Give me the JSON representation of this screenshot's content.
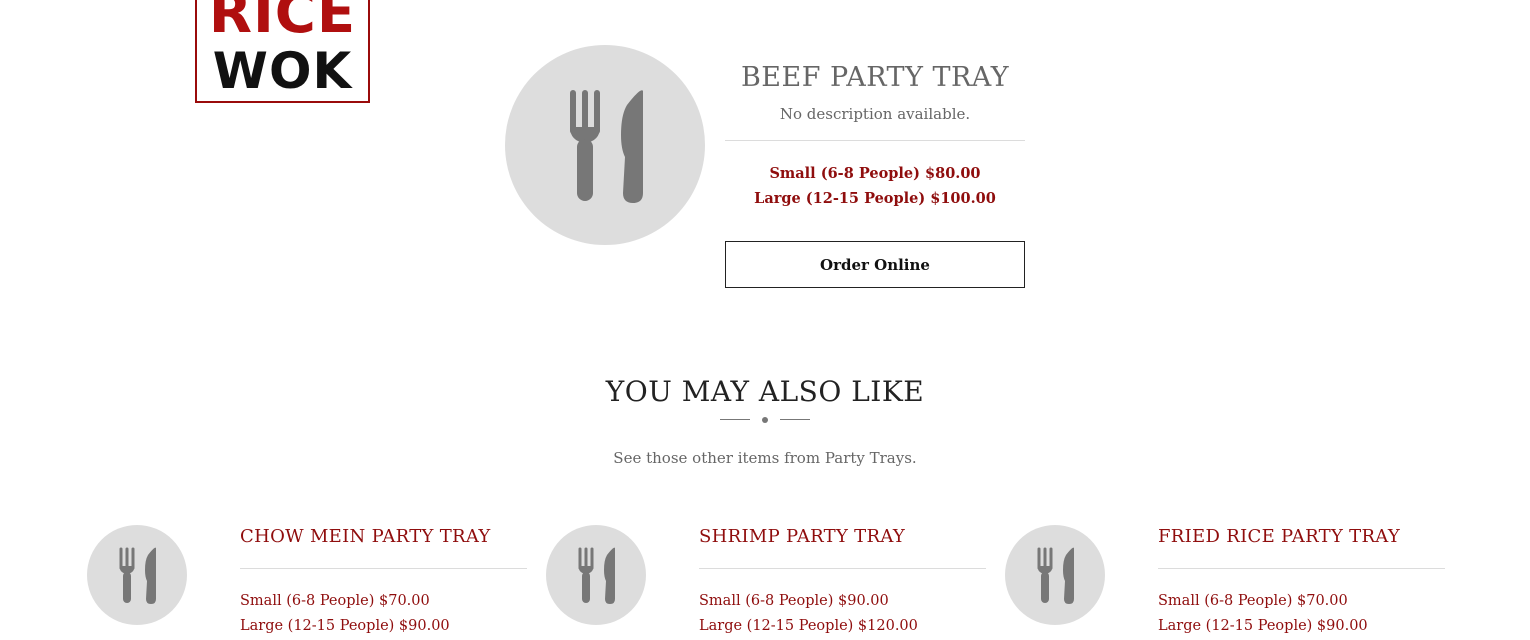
{
  "logo": {
    "line1": "RICE",
    "line2": "WOK",
    "colors": {
      "red": "#b00f0f",
      "black": "#111111"
    }
  },
  "product": {
    "image_icon": "fork-knife-icon",
    "title": "BEEF PARTY TRAY",
    "description": "No description available.",
    "prices": [
      "Small (6-8 People) $80.00",
      "Large (12-15 People) $100.00"
    ],
    "order_button_label": "Order Online"
  },
  "related_section": {
    "title": "YOU MAY ALSO LIKE",
    "subtitle": "See those other items from Party Trays.",
    "items": [
      {
        "image_icon": "fork-knife-icon",
        "title": "CHOW MEIN PARTY TRAY",
        "prices": [
          "Small (6-8 People) $70.00",
          "Large (12-15 People) $90.00"
        ]
      },
      {
        "image_icon": "fork-knife-icon",
        "title": "SHRIMP PARTY TRAY",
        "prices": [
          "Small (6-8 People) $90.00",
          "Large (12-15 People) $120.00"
        ]
      },
      {
        "image_icon": "fork-knife-icon",
        "title": "FRIED RICE PARTY TRAY",
        "prices": [
          "Small (6-8 People) $70.00",
          "Large (12-15 People) $90.00"
        ]
      }
    ]
  },
  "colors": {
    "accent_red": "#8f0d0d",
    "placeholder_gray": "#dddddd",
    "icon_gray": "#777777"
  }
}
